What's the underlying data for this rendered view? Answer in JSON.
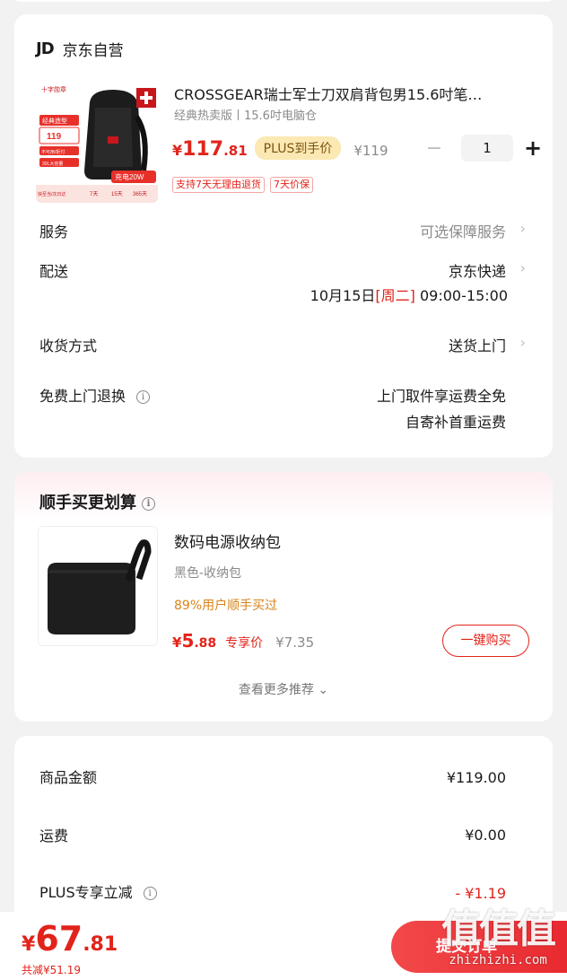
{
  "order_card": {
    "shop_logo": "JD",
    "shop_name": "京东自营",
    "product": {
      "title": "CROSSGEAR瑞士军士刀双肩背包男15.6吋笔…",
      "spec": "经典热卖版丨15.6吋电脑仓",
      "price_yen": "¥",
      "price_int": "117",
      "price_dec": ".81",
      "plus_badge": "PLUS到手价",
      "original_price": "¥119",
      "quantity": "1",
      "minus_symbol": "−",
      "plus_symbol": "+",
      "tags": [
        "支持7天无理由退货",
        "7天价保"
      ],
      "thumb_texts": {
        "brand": "十字勋章",
        "badge": "经典造型",
        "price": "119",
        "promo1": "不可用/拒付",
        "promo2": "30L大容量",
        "charge": "充电20W",
        "bottom1": "快至当/次日达",
        "bottom2": "7天",
        "bottom3": "15天",
        "bottom4": "365天"
      }
    },
    "service": {
      "label": "服务",
      "value": "可选保障服务"
    },
    "delivery": {
      "label": "配送",
      "value": "京东快递",
      "date": "10月15日",
      "weekday": "[周二]",
      "time": "09:00-15:00"
    },
    "receive": {
      "label": "收货方式",
      "value": "送货上门"
    },
    "free_return": {
      "label": "免费上门退换",
      "line1": "上门取件享运费全免",
      "line2": "自寄补首重运费"
    },
    "chevron": "›",
    "info_symbol": "i"
  },
  "recommend": {
    "title": "顺手买更划算",
    "item": {
      "name": "数码电源收纳包",
      "spec": "黑色-收纳包",
      "hint": "89%用户顺手买过",
      "price_yen": "¥",
      "price_int": "5",
      "price_dec": ".88",
      "exclusive": "专享价",
      "original": "¥7.35",
      "buy_label": "一键购买"
    },
    "see_more": "查看更多推荐 ⌄"
  },
  "summary": {
    "rows": [
      {
        "label": "商品金额",
        "value": "¥119.00"
      },
      {
        "label": "运费",
        "value": "¥0.00"
      },
      {
        "label": "PLUS专享立减",
        "value": "- ¥1.19"
      }
    ]
  },
  "bottom": {
    "total_yen": "¥",
    "total_int": "67",
    "total_dec": ".81",
    "saved": "共减¥51.19",
    "submit_label": "提交订单"
  },
  "watermark": {
    "big": "值值值",
    "small": "zhizhizhi.com"
  },
  "colors": {
    "accent_red": "#e2231a",
    "plus_gold": "#fbe8b3",
    "hint_orange": "#d98319"
  }
}
